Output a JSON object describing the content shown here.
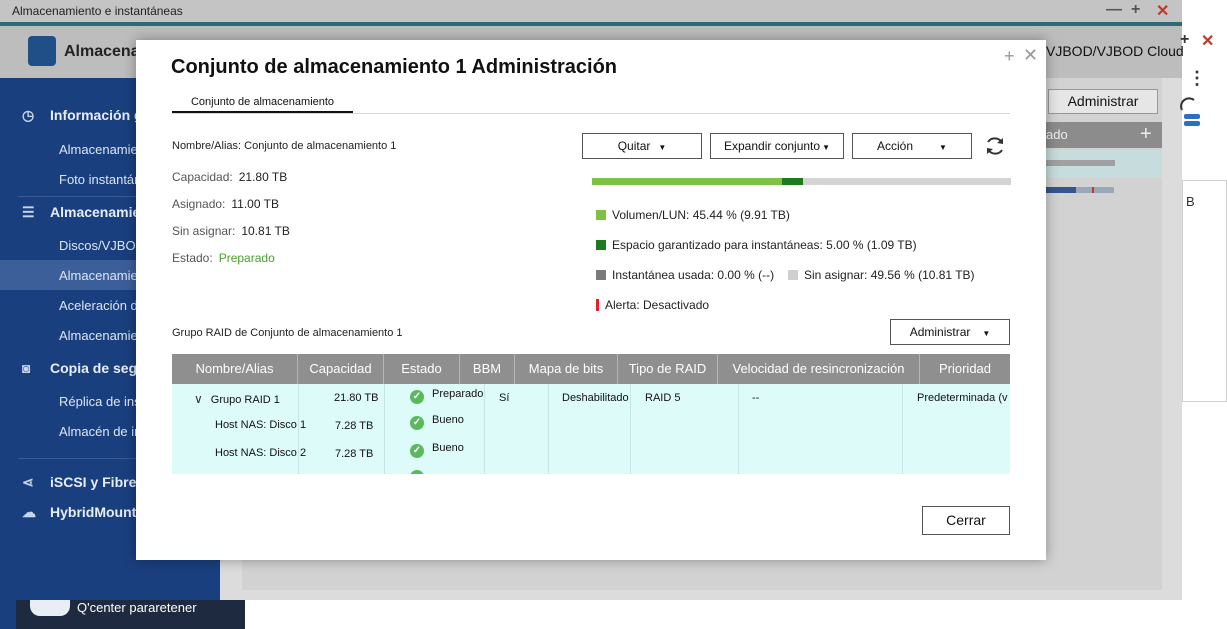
{
  "background": {
    "window_title": "Almacenamiento e instantáneas",
    "window_controls": [
      "—",
      "+",
      "✕"
    ],
    "header_title": "Almacenamiento e instantáneas",
    "header_right": "VJBOD/VJBOD Cloud",
    "admin_button": "Administrar",
    "table_header_partial": "ado",
    "side_controls": [
      "+",
      "✕"
    ],
    "panel_letter": "B",
    "sidebar": {
      "groups": [
        {
          "label": "Información general",
          "icon": "gauge-icon"
        },
        {
          "label": "Almacenamiento",
          "icon": "database-icon"
        },
        {
          "label": "Copia de seguridad de instantáneas",
          "icon": "camera-icon"
        },
        {
          "label": "iSCSI y Fibre Channel",
          "icon": "share-icon"
        },
        {
          "label": "HybridMount",
          "icon": "cloud-icon"
        }
      ],
      "items": [
        "Almacenamiento",
        "Foto instantánea",
        "Discos/VJBOD",
        "Almacenamiento/instantáneas",
        "Aceleración de caché",
        "Almacenamiento externo",
        "Réplica de instantáneas",
        "Almacén de instantáneas"
      ]
    },
    "bottom_app": "Q'center pararetener"
  },
  "modal": {
    "title": "Conjunto de almacenamiento 1 Administración",
    "tab": "Conjunto de almacenamiento",
    "name_alias": "Nombre/Alias: Conjunto de almacenamiento 1",
    "info": [
      {
        "label": "Capacidad:",
        "value": "21.80 TB"
      },
      {
        "label": "Asignado:",
        "value": "11.00 TB"
      },
      {
        "label": "Sin asignar:",
        "value": "10.81 TB"
      },
      {
        "label": "Estado:",
        "value": "Preparado"
      }
    ],
    "buttons": {
      "remove": "Quitar",
      "expand": "Expandir conjunto",
      "action": "Acción",
      "manage": "Administrar",
      "close": "Cerrar"
    },
    "usage": {
      "segments": [
        {
          "name": "Volumen/LUN",
          "percent": 45.44,
          "color": "#7dc242"
        },
        {
          "name": "Espacio garantizado para instantáneas",
          "percent": 5.0,
          "color": "#1e7a1e"
        },
        {
          "name": "Instantánea usada",
          "percent": 0.0,
          "color": "#7a7a7a"
        },
        {
          "name": "Sin asignar",
          "percent": 49.56,
          "color": "#d4d4d4"
        }
      ],
      "legend": {
        "volume": "Volumen/LUN: 45.44 % (9.91 TB)",
        "guaranteed": "Espacio garantizado para instantáneas: 5.00 % (1.09 TB)",
        "used": "Instantánea usada: 0.00 % (--)",
        "unallocated": "Sin asignar: 49.56 % (10.81 TB)",
        "alert": "Alerta: Desactivado"
      },
      "legend_colors": {
        "volume": "#7dc242",
        "guaranteed": "#1e7a1e",
        "used": "#7a7a7a",
        "unallocated": "#cfcfcf",
        "alert": "#e0202a"
      }
    },
    "raid_section_title": "Grupo RAID de Conjunto de almacenamiento 1",
    "table": {
      "headers": [
        "Nombre/Alias",
        "Capacidad",
        "Estado",
        "BBM",
        "Mapa de bits",
        "Tipo de RAID",
        "Velocidad de resincronización",
        "Prioridad"
      ],
      "rows": [
        {
          "name": "Grupo RAID 1",
          "capacity": "21.80 TB",
          "status": "Preparado",
          "bbm": "Sí",
          "bitmap": "Deshabilitado",
          "raid_type": "RAID 5",
          "resync": "--",
          "priority": "Predeterminada (v"
        },
        {
          "name": "Host NAS: Disco 1",
          "capacity": "7.28 TB",
          "status": "Bueno"
        },
        {
          "name": "Host NAS: Disco 2",
          "capacity": "7.28 TB",
          "status": "Bueno"
        }
      ]
    }
  }
}
